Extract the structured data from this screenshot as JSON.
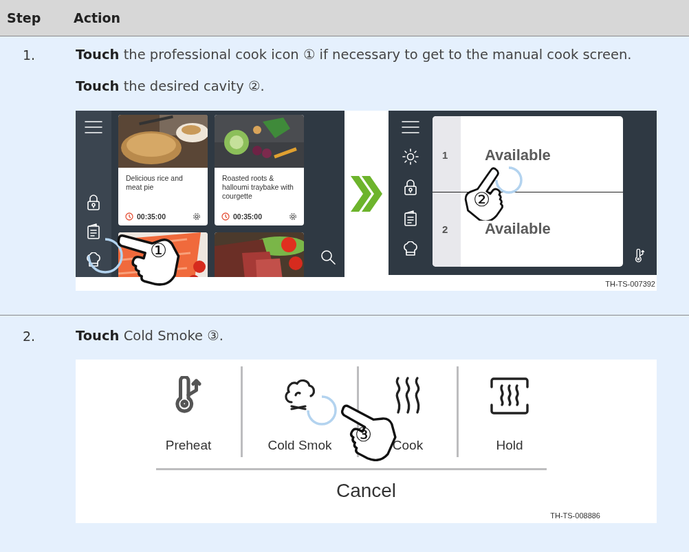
{
  "table": {
    "columns": [
      "Step",
      "Action"
    ],
    "rows": [
      {
        "step": "1.",
        "paragraphs": [
          "**Touch** the professional cook icon ① if necessary to get to the manual cook screen.",
          "**Touch** the desired cavity ②."
        ],
        "figure": {
          "kind": "screens",
          "recipe_screen": {
            "cards": [
              {
                "title": "Delicious rice and meat pie",
                "time": "00:35:00"
              },
              {
                "title": "Roasted roots & halloumi traybake with courgette",
                "time": "00:35:00"
              }
            ],
            "callout": "①"
          },
          "cavity_screen": {
            "cavities": [
              {
                "number": "1",
                "status": "Available"
              },
              {
                "number": "2",
                "status": "Available"
              }
            ],
            "callout": "②"
          },
          "code": "TH-TS-007392"
        }
      },
      {
        "step": "2.",
        "paragraphs": [
          "**Touch** Cold Smoke ③."
        ],
        "figure": {
          "kind": "modes",
          "modes": [
            {
              "label": "Preheat"
            },
            {
              "label": "Cold Smok"
            },
            {
              "label": "Cook"
            },
            {
              "label": "Hold"
            }
          ],
          "cancel": "Cancel",
          "callout": "③",
          "code": "TH-TS-008886"
        }
      }
    ]
  }
}
